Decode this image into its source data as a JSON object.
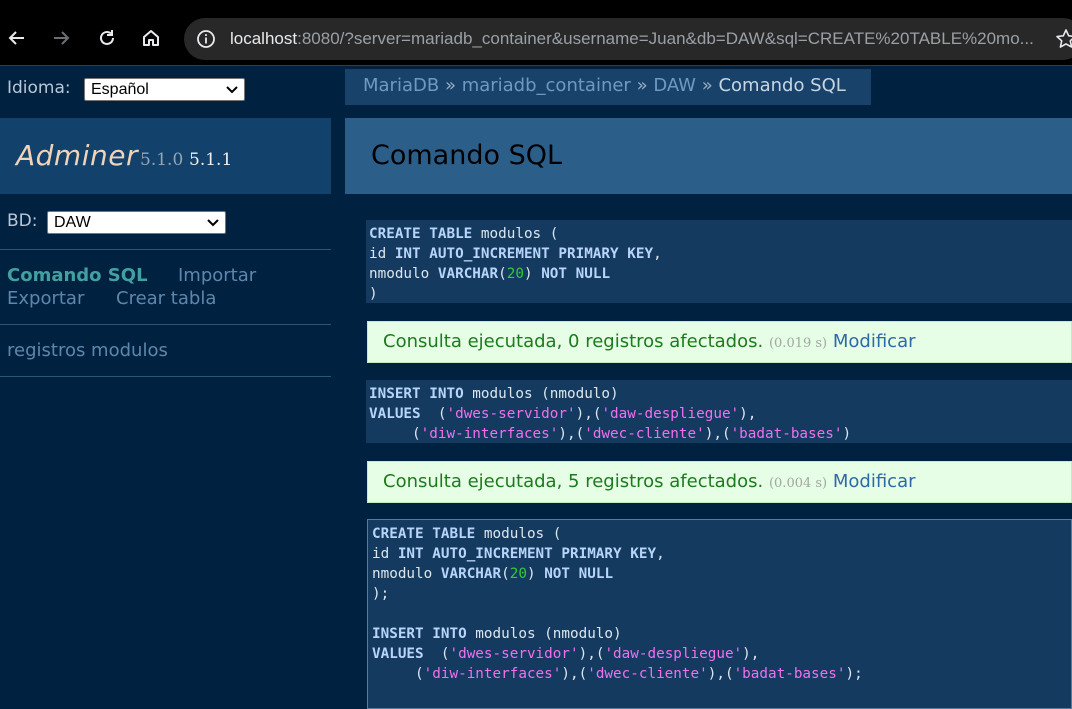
{
  "browser": {
    "url_host": "localhost",
    "url_rest": ":8080/?server=mariadb_container&username=Juan&db=DAW&sql=CREATE%20TABLE%20mo...",
    "icons": [
      "back-arrow-icon",
      "forward-arrow-icon",
      "reload-icon",
      "home-icon",
      "info-icon",
      "star-icon"
    ]
  },
  "sidebar": {
    "language_label": "Idioma:",
    "language_value": "Español",
    "app_name": "Adminer",
    "version_current": "5.1.0",
    "version_new": "5.1.1",
    "db_label": "BD:",
    "db_value": "DAW",
    "links": {
      "sql_command": "Comando SQL",
      "import": "Importar",
      "export": "Exportar",
      "create_table": "Crear tabla"
    },
    "table_item": "registros modulos"
  },
  "breadcrumb": {
    "items": [
      "MariaDB",
      "mariadb_container",
      "DAW"
    ],
    "separator": "»",
    "current": "Comando SQL"
  },
  "page_title": "Comando SQL",
  "results": [
    {
      "message": "Consulta ejecutada, 0 registros afectados.",
      "time": "(0.019 s)",
      "link": "Modificar"
    },
    {
      "message": "Consulta ejecutada, 5 registros afectados.",
      "time": "(0.004 s)",
      "link": "Modificar"
    }
  ],
  "sql": {
    "create_kw": "CREATE TABLE",
    "table_name": " modulos (",
    "id_col": "id",
    "id_type": "INT AUTO_INCREMENT PRIMARY KEY",
    "comma": ",",
    "nmod_col": "nmodulo",
    "varchar_kw": "VARCHAR",
    "varchar_len": "20",
    "not_null": "NOT NULL",
    "close": ")",
    "close_semicolon": ");",
    "insert_kw": "INSERT INTO",
    "insert_rest": " modulos (nmodulo)",
    "values_kw": "VALUES",
    "v1": "'dwes-servidor'",
    "v2": "'daw-despliegue'",
    "v3": "'diw-interfaces'",
    "v4": "'dwec-cliente'",
    "v5": "'badat-bases'"
  }
}
